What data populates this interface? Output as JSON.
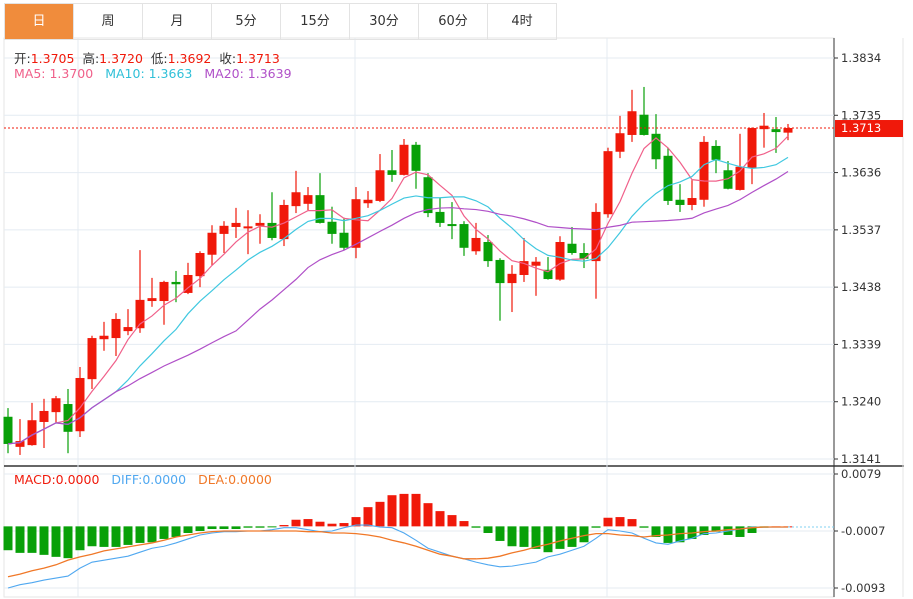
{
  "tabs": [
    {
      "label": "日",
      "active": true
    },
    {
      "label": "周"
    },
    {
      "label": "月"
    },
    {
      "label": "5分"
    },
    {
      "label": "15分"
    },
    {
      "label": "30分"
    },
    {
      "label": "60分"
    },
    {
      "label": "4时"
    }
  ],
  "ohlc_legend": {
    "open_label": "开:",
    "open": "1.3705",
    "high_label": "高:",
    "high": "1.3720",
    "low_label": "低:",
    "low": "1.3692",
    "close_label": "收:",
    "close": "1.3713"
  },
  "ma_legend": {
    "ma5": "MA5: 1.3700",
    "ma10": "MA10: 1.3663",
    "ma20": "MA20: 1.3639"
  },
  "macd_legend": {
    "macd": "MACD:0.0000",
    "diff": "DIFF:0.0000",
    "dea": "DEA:0.0000"
  },
  "colors": {
    "up": "#f0190a",
    "down": "#08a008",
    "ma5": "#f0608a",
    "ma10": "#40c8e0",
    "ma20": "#b050c8",
    "diff": "#50a8f0",
    "dea": "#f07828",
    "tab_active": "#f08c3c"
  },
  "chart_data": [
    {
      "type": "candlestick",
      "price_axis_ticks": [
        "1.3834",
        "1.3735",
        "1.3636",
        "1.3537",
        "1.3438",
        "1.3339",
        "1.3240",
        "1.3141"
      ],
      "ylim": [
        1.3141,
        1.3834
      ],
      "last_price": "1.3713",
      "ma_periods": [
        5,
        10,
        20
      ],
      "candles": [
        [
          1.3214,
          1.3229,
          1.3151,
          1.3167
        ],
        [
          1.3162,
          1.321,
          1.3148,
          1.3172
        ],
        [
          1.3165,
          1.3238,
          1.3164,
          1.3208
        ],
        [
          1.3205,
          1.3245,
          1.316,
          1.3224
        ],
        [
          1.3222,
          1.325,
          1.3203,
          1.3246
        ],
        [
          1.3236,
          1.3262,
          1.3151,
          1.3188
        ],
        [
          1.3189,
          1.33,
          1.3179,
          1.3281
        ],
        [
          1.3279,
          1.3354,
          1.3262,
          1.335
        ],
        [
          1.3348,
          1.3378,
          1.3328,
          1.3354
        ],
        [
          1.335,
          1.3393,
          1.3319,
          1.3383
        ],
        [
          1.3362,
          1.34,
          1.3355,
          1.3369
        ],
        [
          1.3367,
          1.3502,
          1.3359,
          1.3416
        ],
        [
          1.3414,
          1.3454,
          1.3404,
          1.3419
        ],
        [
          1.3414,
          1.3449,
          1.3373,
          1.3447
        ],
        [
          1.3447,
          1.3466,
          1.3412,
          1.3443
        ],
        [
          1.3428,
          1.348,
          1.3426,
          1.3459
        ],
        [
          1.3457,
          1.35,
          1.3438,
          1.3497
        ],
        [
          1.3494,
          1.3545,
          1.3476,
          1.3532
        ],
        [
          1.353,
          1.3552,
          1.3497,
          1.3544
        ],
        [
          1.3542,
          1.3575,
          1.3523,
          1.3549
        ],
        [
          1.3542,
          1.3571,
          1.3495,
          1.3543
        ],
        [
          1.3544,
          1.3564,
          1.3513,
          1.3549
        ],
        [
          1.3549,
          1.3602,
          1.3519,
          1.3523
        ],
        [
          1.3521,
          1.3589,
          1.3509,
          1.358
        ],
        [
          1.3578,
          1.3639,
          1.3566,
          1.3602
        ],
        [
          1.3582,
          1.3611,
          1.3571,
          1.3597
        ],
        [
          1.3597,
          1.3635,
          1.3548,
          1.3549
        ],
        [
          1.3551,
          1.3577,
          1.3513,
          1.353
        ],
        [
          1.3532,
          1.3558,
          1.3502,
          1.3506
        ],
        [
          1.3506,
          1.3611,
          1.3488,
          1.359
        ],
        [
          1.3583,
          1.3604,
          1.3575,
          1.3589
        ],
        [
          1.3587,
          1.3668,
          1.3585,
          1.364
        ],
        [
          1.364,
          1.3675,
          1.362,
          1.3632
        ],
        [
          1.3632,
          1.3694,
          1.3631,
          1.3684
        ],
        [
          1.3684,
          1.3689,
          1.3608,
          1.3639
        ],
        [
          1.3628,
          1.3635,
          1.3559,
          1.3566
        ],
        [
          1.3568,
          1.3592,
          1.3542,
          1.3549
        ],
        [
          1.3547,
          1.3585,
          1.3521,
          1.3545
        ],
        [
          1.3547,
          1.3552,
          1.3492,
          1.3506
        ],
        [
          1.35,
          1.3549,
          1.3494,
          1.3523
        ],
        [
          1.3516,
          1.3528,
          1.3473,
          1.3483
        ],
        [
          1.3485,
          1.3488,
          1.338,
          1.3445
        ],
        [
          1.3445,
          1.3476,
          1.3395,
          1.3461
        ],
        [
          1.3459,
          1.3523,
          1.3447,
          1.3483
        ],
        [
          1.3475,
          1.349,
          1.3423,
          1.3482
        ],
        [
          1.3468,
          1.349,
          1.3451,
          1.3452
        ],
        [
          1.3451,
          1.3526,
          1.3449,
          1.3516
        ],
        [
          1.3513,
          1.3542,
          1.3494,
          1.3497
        ],
        [
          1.3497,
          1.3514,
          1.3471,
          1.3487
        ],
        [
          1.3483,
          1.3583,
          1.3418,
          1.3568
        ],
        [
          1.3564,
          1.3679,
          1.3558,
          1.3673
        ],
        [
          1.3672,
          1.3734,
          1.3661,
          1.3704
        ],
        [
          1.3701,
          1.3779,
          1.3689,
          1.3742
        ],
        [
          1.3736,
          1.3784,
          1.37,
          1.3701
        ],
        [
          1.3703,
          1.3737,
          1.3642,
          1.3659
        ],
        [
          1.3665,
          1.3679,
          1.358,
          1.3587
        ],
        [
          1.3589,
          1.3616,
          1.3568,
          1.358
        ],
        [
          1.358,
          1.3623,
          1.3571,
          1.3592
        ],
        [
          1.3589,
          1.3699,
          1.3577,
          1.3689
        ],
        [
          1.3682,
          1.3692,
          1.3635,
          1.3658
        ],
        [
          1.364,
          1.3656,
          1.3607,
          1.3608
        ],
        [
          1.3606,
          1.3703,
          1.3605,
          1.3646
        ],
        [
          1.3644,
          1.3714,
          1.3616,
          1.3713
        ],
        [
          1.3711,
          1.3739,
          1.3679,
          1.3717
        ],
        [
          1.3711,
          1.3732,
          1.367,
          1.3706
        ],
        [
          1.3705,
          1.372,
          1.3692,
          1.3713
        ]
      ]
    },
    {
      "type": "bar+line",
      "axis_ticks": [
        "0.0079",
        "-0.0007",
        "-0.0093"
      ],
      "ylim": [
        -0.0093,
        0.0079
      ],
      "macd": [
        -0.0036,
        -0.004,
        -0.004,
        -0.0043,
        -0.0046,
        -0.0048,
        -0.0036,
        -0.003,
        -0.0031,
        -0.0031,
        -0.0028,
        -0.0025,
        -0.0024,
        -0.0019,
        -0.0016,
        -0.001,
        -0.0007,
        -0.0004,
        -0.0004,
        -0.0004,
        -0.0002,
        -0.0002,
        -0.0001,
        0.0002,
        0.001,
        0.0011,
        0.0007,
        0.0004,
        0.0005,
        0.0014,
        0.0029,
        0.0037,
        0.0047,
        0.0049,
        0.0049,
        0.0035,
        0.0023,
        0.0017,
        0.0008,
        -0.0002,
        -0.001,
        -0.0022,
        -0.003,
        -0.0031,
        -0.0034,
        -0.0039,
        -0.0034,
        -0.0031,
        -0.0024,
        -0.0002,
        0.0013,
        0.0014,
        0.0011,
        -0.0002,
        -0.0016,
        -0.0025,
        -0.0024,
        -0.0019,
        -0.0013,
        -0.0008,
        -0.0013,
        -0.0016,
        -0.001,
        -0.0002,
        0,
        0
      ],
      "diff": [
        -0.0093,
        -0.0088,
        -0.0085,
        -0.0081,
        -0.0078,
        -0.0075,
        -0.0063,
        -0.0054,
        -0.0051,
        -0.0048,
        -0.0045,
        -0.0039,
        -0.0033,
        -0.003,
        -0.0025,
        -0.0019,
        -0.0013,
        -0.001,
        -0.0008,
        -0.0008,
        -0.0007,
        -0.0007,
        -0.0005,
        -0.0002,
        -0.0002,
        -0.0005,
        -0.0008,
        -0.0007,
        -0.0002,
        0.0002,
        0.0002,
        -0.0001,
        -0.0002,
        -0.001,
        -0.0021,
        -0.0033,
        -0.0039,
        -0.0045,
        -0.0049,
        -0.0054,
        -0.0058,
        -0.0061,
        -0.006,
        -0.0057,
        -0.0054,
        -0.0046,
        -0.0042,
        -0.0036,
        -0.003,
        -0.0018,
        -0.0005,
        -0.0007,
        -0.001,
        -0.0018,
        -0.0025,
        -0.0027,
        -0.0022,
        -0.0018,
        -0.0011,
        -0.001,
        -0.0007,
        -0.0004,
        -0.0001,
        -0.0001,
        -0.0001,
        -0.0001
      ],
      "dea": [
        -0.0076,
        -0.0072,
        -0.0067,
        -0.0063,
        -0.0058,
        -0.0051,
        -0.0046,
        -0.0042,
        -0.0037,
        -0.0034,
        -0.0031,
        -0.0028,
        -0.0025,
        -0.0021,
        -0.0016,
        -0.0013,
        -0.001,
        -0.0008,
        -0.0007,
        -0.0007,
        -0.0007,
        -0.0007,
        -0.0007,
        -0.0007,
        -0.0007,
        -0.0008,
        -0.0008,
        -0.001,
        -0.001,
        -0.0011,
        -0.0013,
        -0.0016,
        -0.0021,
        -0.0025,
        -0.003,
        -0.0036,
        -0.0042,
        -0.0045,
        -0.0049,
        -0.0049,
        -0.0048,
        -0.0045,
        -0.004,
        -0.0036,
        -0.0031,
        -0.0027,
        -0.0022,
        -0.0018,
        -0.0014,
        -0.0011,
        -0.0011,
        -0.0013,
        -0.0014,
        -0.0016,
        -0.0014,
        -0.0013,
        -0.0011,
        -0.001,
        -0.0008,
        -0.0007,
        -0.0005,
        -0.0004,
        -0.0002,
        -0.0001,
        -0.0001,
        -0.0001
      ]
    }
  ]
}
